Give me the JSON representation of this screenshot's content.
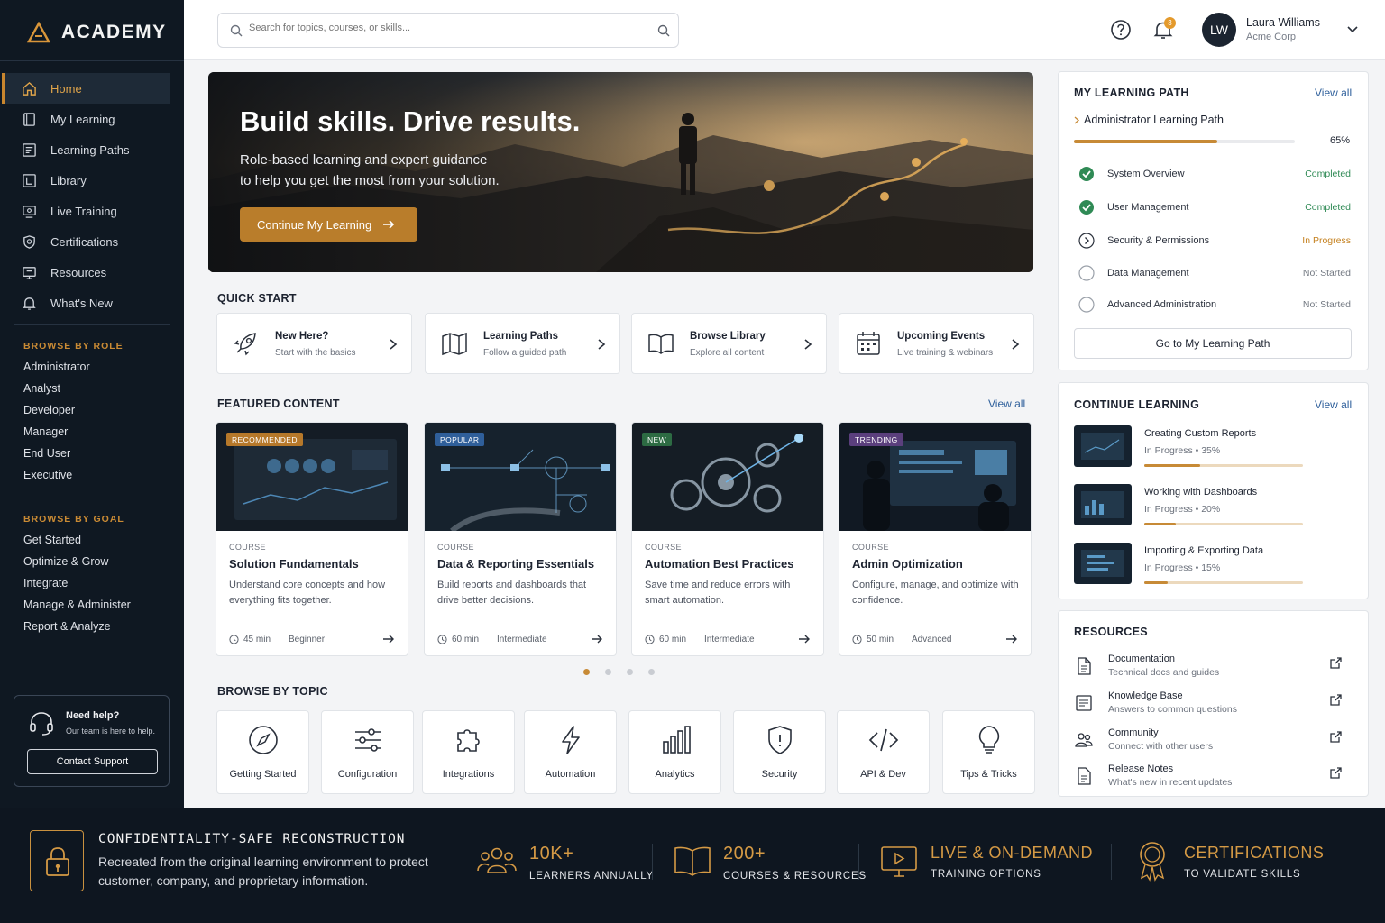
{
  "app": {
    "logo_text": "ACADEMY"
  },
  "sidebar": {
    "nav": [
      {
        "label": "Home",
        "icon": "home-icon",
        "active": true
      },
      {
        "label": "My Learning",
        "icon": "book-icon"
      },
      {
        "label": "Learning Paths",
        "icon": "path-icon"
      },
      {
        "label": "Library",
        "icon": "library-icon"
      },
      {
        "label": "Live Training",
        "icon": "video-icon"
      },
      {
        "label": "Certifications",
        "icon": "badge-icon"
      },
      {
        "label": "Resources",
        "icon": "resources-icon"
      },
      {
        "label": "What's New",
        "icon": "bell-icon"
      }
    ],
    "browse_by_role": {
      "title": "BROWSE BY ROLE",
      "items": [
        "Administrator",
        "Analyst",
        "Developer",
        "Manager",
        "End User",
        "Executive"
      ]
    },
    "browse_by_goal": {
      "title": "BROWSE BY GOAL",
      "items": [
        "Get Started",
        "Optimize & Grow",
        "Integrate",
        "Manage & Administer",
        "Report & Analyze"
      ]
    },
    "help": {
      "title": "Need help?",
      "subtitle": "Our team is here to help.",
      "button": "Contact Support"
    }
  },
  "header": {
    "search_placeholder": "Search for topics, courses, or skills...",
    "notification_count": "3",
    "user": {
      "initials": "LW",
      "name": "Laura Williams",
      "org": "Acme Corp"
    }
  },
  "hero": {
    "title": "Build skills. Drive results.",
    "subtitle_line1": "Role-based learning and expert guidance",
    "subtitle_line2": "to help you get the most from your solution.",
    "button": "Continue My Learning"
  },
  "quick_start": {
    "title": "QUICK START",
    "items": [
      {
        "title": "New Here?",
        "subtitle": "Start with the basics",
        "icon": "rocket-icon"
      },
      {
        "title": "Learning Paths",
        "subtitle": "Follow a guided path",
        "icon": "map-icon"
      },
      {
        "title": "Browse Library",
        "subtitle": "Explore all content",
        "icon": "open-book-icon"
      },
      {
        "title": "Upcoming Events",
        "subtitle": "Live training & webinars",
        "icon": "calendar-icon"
      }
    ]
  },
  "featured": {
    "title": "FEATURED CONTENT",
    "view_all": "View all",
    "cards": [
      {
        "tag": "RECOMMENDED",
        "tag_color": "#b6782a",
        "kind": "COURSE",
        "title": "Solution Fundamentals",
        "desc": "Understand core concepts and how everything fits together.",
        "time": "45 min",
        "level": "Beginner"
      },
      {
        "tag": "POPULAR",
        "tag_color": "#2f5f9a",
        "kind": "COURSE",
        "title": "Data & Reporting Essentials",
        "desc": "Build reports and dashboards that drive better decisions.",
        "time": "60 min",
        "level": "Intermediate"
      },
      {
        "tag": "NEW",
        "tag_color": "#2d6b43",
        "kind": "COURSE",
        "title": "Automation Best Practices",
        "desc": "Save time and reduce errors with smart automation.",
        "time": "60 min",
        "level": "Intermediate"
      },
      {
        "tag": "TRENDING",
        "tag_color": "#5b3f7d",
        "kind": "COURSE",
        "title": "Admin Optimization",
        "desc": "Configure, manage, and optimize with confidence.",
        "time": "50 min",
        "level": "Advanced"
      }
    ]
  },
  "topics": {
    "title": "BROWSE BY TOPIC",
    "items": [
      {
        "label": "Getting Started",
        "icon": "compass-icon"
      },
      {
        "label": "Configuration",
        "icon": "sliders-icon"
      },
      {
        "label": "Integrations",
        "icon": "puzzle-icon"
      },
      {
        "label": "Automation",
        "icon": "lightning-icon"
      },
      {
        "label": "Analytics",
        "icon": "bar-chart-icon"
      },
      {
        "label": "Security",
        "icon": "shield-icon"
      },
      {
        "label": "API & Dev",
        "icon": "code-icon"
      },
      {
        "label": "Tips & Tricks",
        "icon": "lightbulb-icon"
      }
    ]
  },
  "learning_path": {
    "title": "MY LEARNING PATH",
    "view_all": "View all",
    "path_name": "Administrator Learning Path",
    "progress_percent": 65,
    "progress_label": "65%",
    "items": [
      {
        "title": "System Overview",
        "status": "Completed",
        "state": "done"
      },
      {
        "title": "User Management",
        "status": "Completed",
        "state": "done"
      },
      {
        "title": "Security & Permissions",
        "status": "In Progress",
        "state": "progress"
      },
      {
        "title": "Data Management",
        "status": "Not Started",
        "state": "todo"
      },
      {
        "title": "Advanced Administration",
        "status": "Not Started",
        "state": "todo"
      }
    ],
    "button": "Go to My Learning Path",
    "colors": {
      "completed": "#2f8a55",
      "in_progress": "#c5811f",
      "not_started": "#737982"
    }
  },
  "continue_learning": {
    "title": "CONTINUE LEARNING",
    "view_all": "View all",
    "items": [
      {
        "title": "Creating Custom Reports",
        "status": "In Progress",
        "percent_label": "35%",
        "percent": 35
      },
      {
        "title": "Working with Dashboards",
        "status": "In Progress",
        "percent_label": "20%",
        "percent": 20
      },
      {
        "title": "Importing & Exporting Data",
        "status": "In Progress",
        "percent_label": "15%",
        "percent": 15
      }
    ]
  },
  "resources": {
    "title": "RESOURCES",
    "items": [
      {
        "title": "Documentation",
        "subtitle": "Technical docs and guides",
        "icon": "document-icon"
      },
      {
        "title": "Knowledge Base",
        "subtitle": "Answers to common questions",
        "icon": "knowledge-icon"
      },
      {
        "title": "Community",
        "subtitle": "Connect with other users",
        "icon": "community-icon"
      },
      {
        "title": "Release Notes",
        "subtitle": "What's new in recent updates",
        "icon": "notes-icon"
      }
    ]
  },
  "footer": {
    "title": "CONFIDENTIALITY-SAFE RECONSTRUCTION",
    "text": "Recreated from the original learning environment to protect customer, company, and proprietary information.",
    "stats": [
      {
        "big": "10K+",
        "small": "LEARNERS ANNUALLY"
      },
      {
        "big": "200+",
        "small": "COURSES & RESOURCES"
      },
      {
        "big": "LIVE & ON-DEMAND",
        "small": "TRAINING OPTIONS"
      },
      {
        "big": "CERTIFICATIONS",
        "small": "TO VALIDATE SKILLS"
      }
    ],
    "accent": "#d59a45"
  }
}
